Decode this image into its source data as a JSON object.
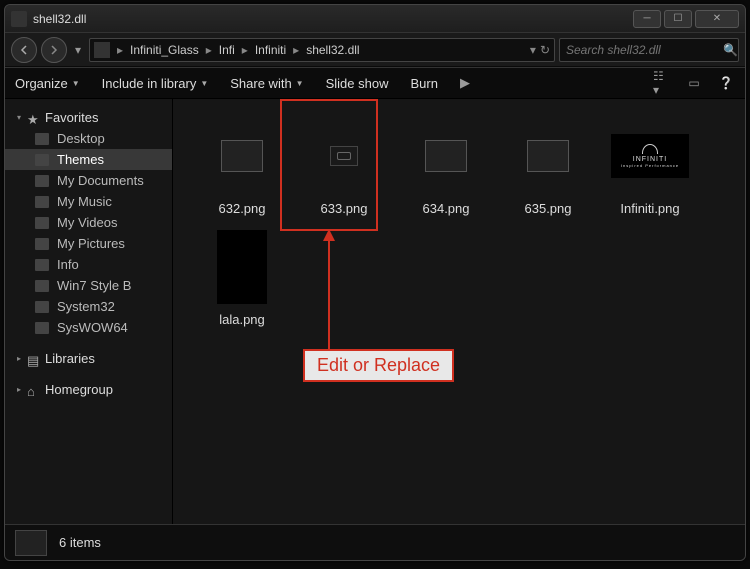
{
  "window": {
    "title": "shell32.dll"
  },
  "nav": {
    "breadcrumb": [
      "Infiniti_Glass",
      "Infi",
      "Infiniti",
      "shell32.dll"
    ],
    "search_placeholder": "Search shell32.dll"
  },
  "toolbar": {
    "organize": "Organize",
    "include": "Include in library",
    "share": "Share with",
    "slideshow": "Slide show",
    "burn": "Burn"
  },
  "sidebar": {
    "favorites": {
      "label": "Favorites",
      "items": [
        "Desktop",
        "Themes",
        "My Documents",
        "My Music",
        "My Videos",
        "My Pictures",
        "Info",
        "Win7 Style B",
        "System32",
        "SysWOW64"
      ],
      "selected_index": 1
    },
    "libraries": {
      "label": "Libraries"
    },
    "homegroup": {
      "label": "Homegroup"
    }
  },
  "files": [
    {
      "name": "632.png",
      "thumb": "small"
    },
    {
      "name": "633.png",
      "thumb": "tiny"
    },
    {
      "name": "634.png",
      "thumb": "small"
    },
    {
      "name": "635.png",
      "thumb": "small"
    },
    {
      "name": "Infiniti.png",
      "thumb": "infiniti"
    },
    {
      "name": "lala.png",
      "thumb": "black"
    }
  ],
  "status": {
    "count": "6 items"
  },
  "annotation": {
    "label": "Edit or Replace",
    "highlighted_file_index": 1
  },
  "infiniti": {
    "brand": "INFINITI",
    "tagline": "Inspired Performance"
  }
}
